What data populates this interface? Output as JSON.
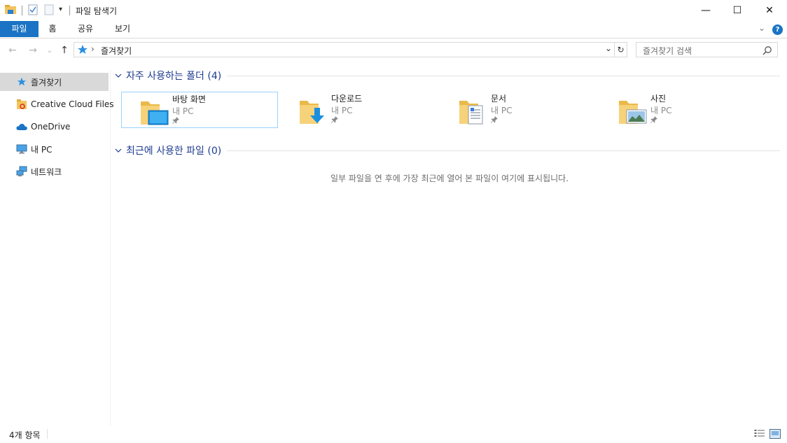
{
  "window": {
    "title": "파일 탐색기",
    "controls": {
      "minimize": "—",
      "maximize": "☐",
      "close": "✕"
    }
  },
  "ribbon": {
    "tabs": [
      {
        "label": "파일",
        "active": true
      },
      {
        "label": "홈"
      },
      {
        "label": "공유"
      },
      {
        "label": "보기"
      }
    ],
    "help": "?"
  },
  "navigation": {
    "back": "←",
    "forward": "→",
    "recent": "⌄",
    "up": "↑",
    "address_separator": "›",
    "address_text": "즐겨찾기",
    "address_dropdown": "⌄",
    "refresh": "↻",
    "search_placeholder": "즐겨찾기 검색"
  },
  "sidebar": {
    "items": [
      {
        "label": "즐겨찾기",
        "icon": "star-icon",
        "selected": true
      },
      {
        "label": "Creative Cloud Files",
        "icon": "creative-cloud-folder-icon"
      },
      {
        "label": "OneDrive",
        "icon": "onedrive-cloud-icon"
      },
      {
        "label": "내 PC",
        "icon": "pc-monitor-icon"
      },
      {
        "label": "네트워크",
        "icon": "network-icon"
      }
    ]
  },
  "main": {
    "frequent_folders": {
      "title": "자주 사용하는 폴더 (4)",
      "items": [
        {
          "name": "바탕 화면",
          "location": "내 PC",
          "icon": "desktop-folder-icon",
          "selected": true
        },
        {
          "name": "다운로드",
          "location": "내 PC",
          "icon": "downloads-folder-icon"
        },
        {
          "name": "문서",
          "location": "내 PC",
          "icon": "documents-folder-icon"
        },
        {
          "name": "사진",
          "location": "내 PC",
          "icon": "pictures-folder-icon"
        }
      ]
    },
    "recent_files": {
      "title": "최근에 사용한 파일 (0)",
      "empty_message": "일부 파일을 연 후에 가장 최근에 열어 본 파일이 여기에 표시됩니다."
    }
  },
  "status": {
    "item_count": "4개 항목"
  },
  "colors": {
    "accent": "#1a73c4",
    "group_title": "#1e3b8f",
    "folder": "#f2c55c",
    "selection_border": "#99d1ff"
  }
}
